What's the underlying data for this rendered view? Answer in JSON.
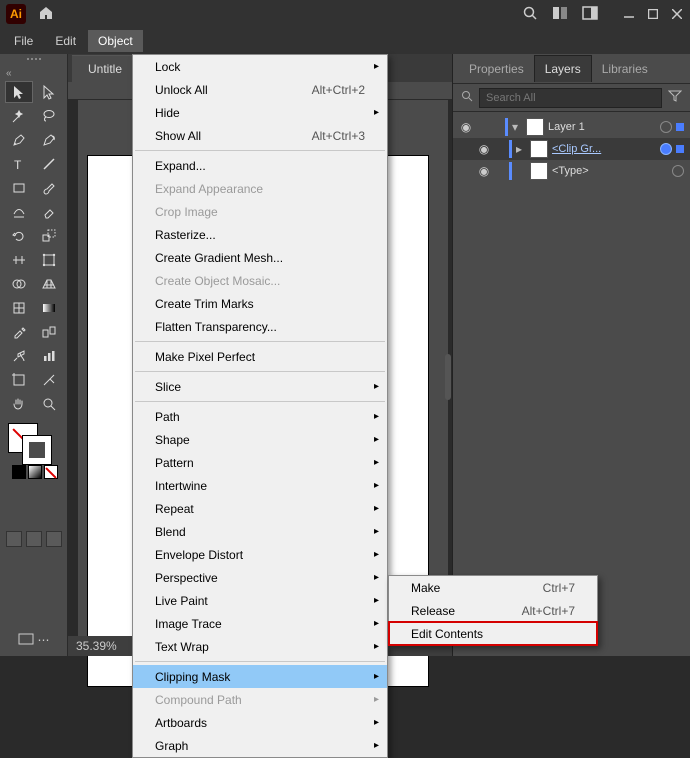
{
  "app_badge": "Ai",
  "menubar": {
    "file": "File",
    "edit": "Edit",
    "object": "Object"
  },
  "doc_tab": "Untitle",
  "status_zoom": "35.39%",
  "right_panel": {
    "tabs": {
      "properties": "Properties",
      "layers": "Layers",
      "libraries": "Libraries"
    },
    "search_placeholder": "Search All",
    "layers": [
      {
        "name": "Layer 1"
      },
      {
        "name": "<Clip Gr..."
      },
      {
        "name": "<Type>"
      }
    ]
  },
  "object_menu": [
    {
      "label": "Lock",
      "sub": true,
      "sep_before": false
    },
    {
      "label": "Unlock All",
      "shortcut": "Alt+Ctrl+2"
    },
    {
      "label": "Hide",
      "sub": true
    },
    {
      "label": "Show All",
      "shortcut": "Alt+Ctrl+3",
      "sep_after": true
    },
    {
      "label": "Expand..."
    },
    {
      "label": "Expand Appearance",
      "disabled": true
    },
    {
      "label": "Crop Image",
      "disabled": true
    },
    {
      "label": "Rasterize..."
    },
    {
      "label": "Create Gradient Mesh..."
    },
    {
      "label": "Create Object Mosaic...",
      "disabled": true
    },
    {
      "label": "Create Trim Marks"
    },
    {
      "label": "Flatten Transparency...",
      "sep_after": true
    },
    {
      "label": "Make Pixel Perfect",
      "sep_after": true
    },
    {
      "label": "Slice",
      "sub": true,
      "sep_after": true
    },
    {
      "label": "Path",
      "sub": true
    },
    {
      "label": "Shape",
      "sub": true
    },
    {
      "label": "Pattern",
      "sub": true
    },
    {
      "label": "Intertwine",
      "sub": true
    },
    {
      "label": "Repeat",
      "sub": true
    },
    {
      "label": "Blend",
      "sub": true
    },
    {
      "label": "Envelope Distort",
      "sub": true
    },
    {
      "label": "Perspective",
      "sub": true
    },
    {
      "label": "Live Paint",
      "sub": true
    },
    {
      "label": "Image Trace",
      "sub": true
    },
    {
      "label": "Text Wrap",
      "sub": true,
      "sep_after": true
    },
    {
      "label": "Clipping Mask",
      "sub": true,
      "highlight": true
    },
    {
      "label": "Compound Path",
      "sub": true,
      "disabled": true
    },
    {
      "label": "Artboards",
      "sub": true
    },
    {
      "label": "Graph",
      "sub": true
    }
  ],
  "clipping_submenu": [
    {
      "label": "Make",
      "shortcut": "Ctrl+7"
    },
    {
      "label": "Release",
      "shortcut": "Alt+Ctrl+7"
    },
    {
      "label": "Edit Contents",
      "boxed": true
    }
  ]
}
